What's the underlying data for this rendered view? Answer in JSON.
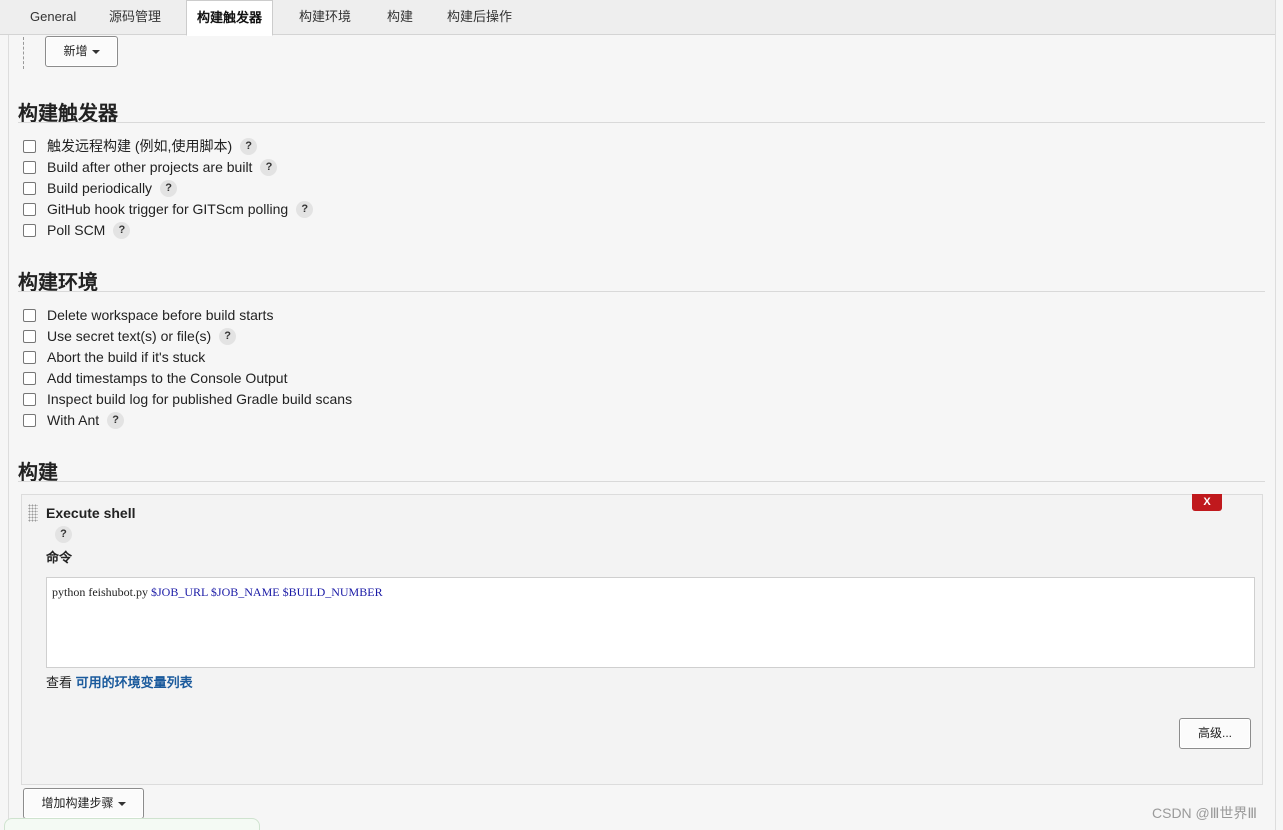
{
  "tabs": [
    {
      "label": "General",
      "active": false
    },
    {
      "label": "源码管理",
      "active": false
    },
    {
      "label": "构建触发器",
      "active": true
    },
    {
      "label": "构建环境",
      "active": false
    },
    {
      "label": "构建",
      "active": false
    },
    {
      "label": "构建后操作",
      "active": false
    }
  ],
  "add_button": {
    "label": "新增"
  },
  "triggers": {
    "title": "构建触发器",
    "options": [
      {
        "label": "触发远程构建 (例如,使用脚本)",
        "checked": false,
        "help": "?"
      },
      {
        "label": "Build after other projects are built",
        "checked": false,
        "help": "?"
      },
      {
        "label": "Build periodically",
        "checked": false,
        "help": "?"
      },
      {
        "label": "GitHub hook trigger for GITScm polling",
        "checked": false,
        "help": "?"
      },
      {
        "label": "Poll SCM",
        "checked": false,
        "help": "?"
      }
    ]
  },
  "environment": {
    "title": "构建环境",
    "options": [
      {
        "label": "Delete workspace before build starts",
        "checked": false
      },
      {
        "label": "Use secret text(s) or file(s)",
        "checked": false,
        "help": "?"
      },
      {
        "label": "Abort the build if it's stuck",
        "checked": false
      },
      {
        "label": "Add timestamps to the Console Output",
        "checked": false
      },
      {
        "label": "Inspect build log for published Gradle build scans",
        "checked": false
      },
      {
        "label": "With Ant",
        "checked": false,
        "help": "?"
      }
    ]
  },
  "build": {
    "title": "构建",
    "step": {
      "title": "Execute shell",
      "help": "?",
      "delete_label": "X",
      "command_label": "命令",
      "command_parts": {
        "plain": "python feishubot.py ",
        "vars": "$JOB_URL $JOB_NAME $BUILD_NUMBER"
      },
      "env_prefix": "查看 ",
      "env_link": "可用的环境变量列表",
      "advanced_label": "高级..."
    },
    "add_step_label": "增加构建步骤"
  },
  "watermark": "CSDN @Ⅲ世界Ⅲ"
}
